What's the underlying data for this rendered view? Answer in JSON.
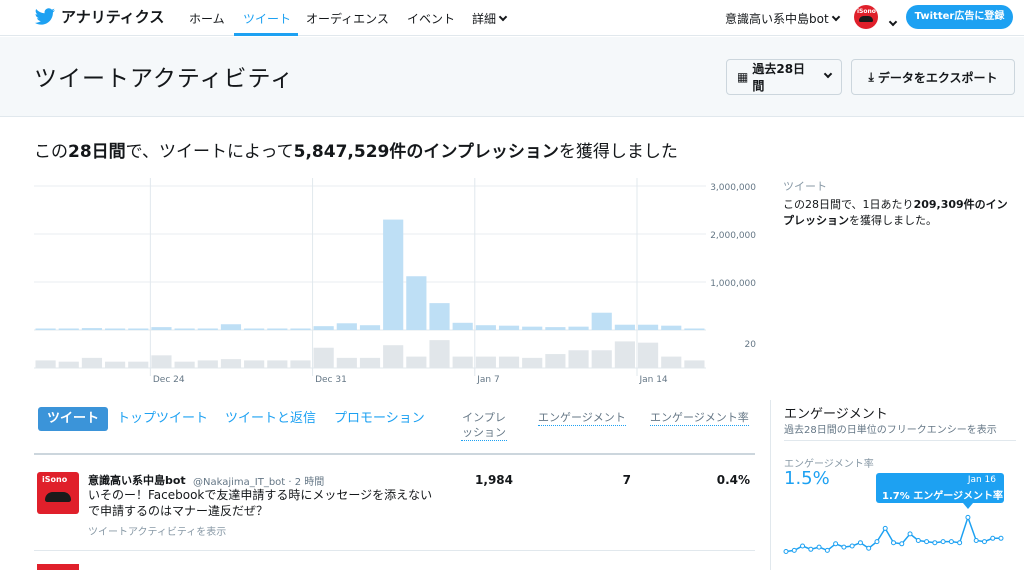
{
  "nav": {
    "brand": "アナリティクス",
    "links": [
      "ホーム",
      "ツイート",
      "オーディエンス",
      "イベント",
      "詳細"
    ],
    "account": "意識高い系中島bot",
    "avatar_text": "iSono",
    "cta": "Twitter広告に登録"
  },
  "header": {
    "title": "ツイートアクティビティ",
    "period_button": "過去28日間",
    "export_button": "データをエクスポート"
  },
  "summary": {
    "prefix": "この",
    "period": "28日間",
    "middle": "で、ツイートによって",
    "impressions": "5,847,529件のインプレッション",
    "suffix": "を獲得しました"
  },
  "side_panel": {
    "label": "ツイート",
    "text_prefix": "この28日間で、1日あたり",
    "text_bold": "209,309件のインプレッション",
    "text_suffix": "を獲得しました。"
  },
  "chart_data": {
    "type": "bar",
    "categories": [
      "Dec 19",
      "Dec 20",
      "Dec 21",
      "Dec 22",
      "Dec 23",
      "Dec 24",
      "Dec 25",
      "Dec 26",
      "Dec 27",
      "Dec 28",
      "Dec 29",
      "Dec 30",
      "Dec 31",
      "Jan 1",
      "Jan 2",
      "Jan 3",
      "Jan 4",
      "Jan 5",
      "Jan 6",
      "Jan 7",
      "Jan 8",
      "Jan 9",
      "Jan 10",
      "Jan 11",
      "Jan 12",
      "Jan 13",
      "Jan 14",
      "Jan 15",
      "Jan 16"
    ],
    "x_tick_labels": [
      "Dec 24",
      "Dec 31",
      "Jan 7",
      "Jan 14"
    ],
    "series": [
      {
        "values": [
          20000,
          20000,
          40000,
          20000,
          20000,
          60000,
          20000,
          20000,
          120000,
          20000,
          20000,
          20000,
          80000,
          140000,
          100000,
          2300000,
          1120000,
          560000,
          150000,
          100000,
          90000,
          70000,
          60000,
          70000,
          360000,
          110000,
          110000,
          90000,
          30000
        ]
      },
      {
        "values": [
          6,
          5,
          8,
          5,
          5,
          10,
          5,
          6,
          7,
          6,
          6,
          6,
          16,
          8,
          8,
          18,
          9,
          22,
          9,
          9,
          9,
          8,
          11,
          14,
          14,
          21,
          20,
          9,
          6
        ]
      }
    ],
    "y_tick_labels": [
      "3,000,000",
      "2,000,000",
      "1,000,000"
    ],
    "y2_tick_labels": [
      "20"
    ],
    "ylim": [
      0,
      3000000
    ],
    "y2lim": [
      0,
      30
    ]
  },
  "tabs": [
    "ツイート",
    "トップツイート",
    "ツイートと返信",
    "プロモーション"
  ],
  "columns": [
    "インプレッション",
    "エンゲージメント",
    "エンゲージメント率"
  ],
  "tweet": {
    "name": "意識高い系中島bot",
    "handle": "@Nakajima_IT_bot · 2 時間",
    "text": "いそのー！Facebookで友達申請する時にメッセージを添えないで申請するのはマナー違反だぜ？",
    "link": "ツイートアクティビティを表示",
    "impressions": "1,984",
    "engagements": "7",
    "rate": "0.4%",
    "avatar_text": "iSono"
  },
  "engagement_panel": {
    "title": "エンゲージメント",
    "subtitle": "過去28日間の日単位のフリークエンシーを表示",
    "rate_label": "エンゲージメント率",
    "rate_value": "1.5%",
    "tooltip_date": "Jan 16",
    "tooltip_value": "1.7% エンゲージメント率",
    "spark": [
      0.5,
      0.6,
      1.0,
      0.7,
      0.9,
      0.6,
      1.2,
      0.9,
      1.0,
      1.3,
      0.8,
      1.4,
      2.6,
      1.3,
      1.2,
      2.1,
      1.5,
      1.4,
      1.3,
      1.4,
      1.4,
      1.3,
      3.6,
      1.5,
      1.4,
      1.7,
      1.7
    ]
  }
}
